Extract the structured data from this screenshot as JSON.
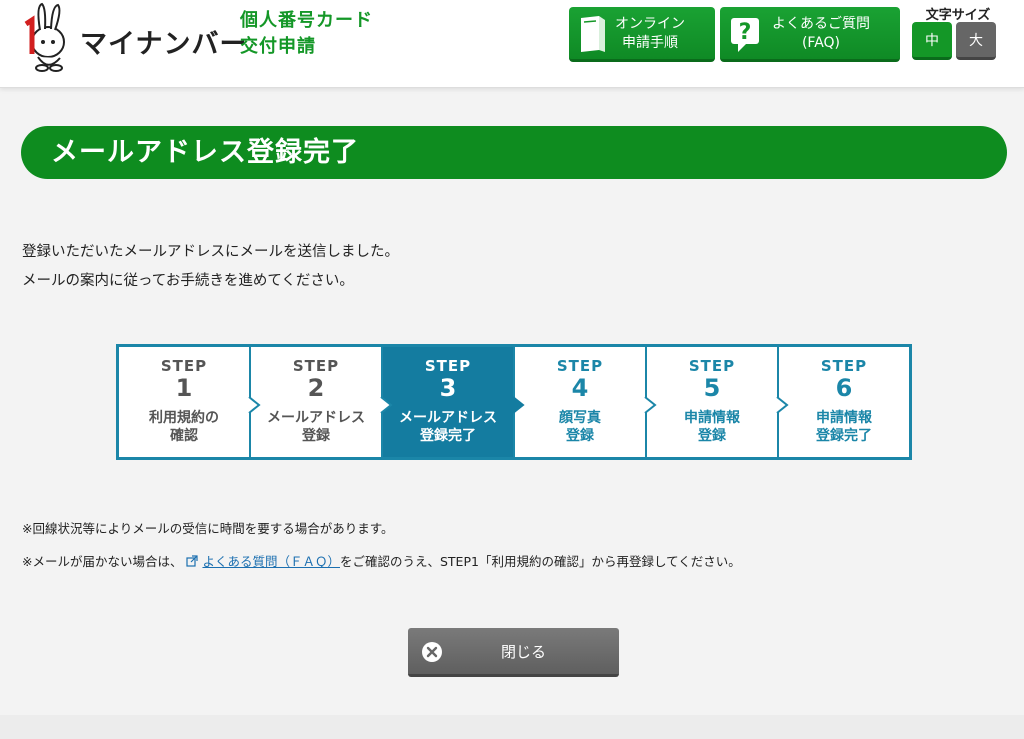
{
  "header": {
    "logo_text": "マイナンバー",
    "service_title_line1": "個人番号カード",
    "service_title_line2": "交付申請",
    "online_btn_line1": "オンライン",
    "online_btn_line2": "申請手順",
    "faq_btn_line1": "よくあるご質問",
    "faq_btn_line2": "(FAQ)",
    "font_size_label": "文字サイズ",
    "font_mid": "中",
    "font_large": "大"
  },
  "page_title": "メールアドレス登録完了",
  "message": {
    "line1": "登録いただいたメールアドレスにメールを送信しました。",
    "line2": "メールの案内に従ってお手続きを進めてください。"
  },
  "steps": [
    {
      "word": "STEP",
      "num": "1",
      "name1": "利用規約の",
      "name2": "確認"
    },
    {
      "word": "STEP",
      "num": "2",
      "name1": "メールアドレス",
      "name2": "登録"
    },
    {
      "word": "STEP",
      "num": "3",
      "name1": "メールアドレス",
      "name2": "登録完了"
    },
    {
      "word": "STEP",
      "num": "4",
      "name1": "顔写真",
      "name2": "登録"
    },
    {
      "word": "STEP",
      "num": "5",
      "name1": "申請情報",
      "name2": "登録"
    },
    {
      "word": "STEP",
      "num": "6",
      "name1": "申請情報",
      "name2": "登録完了"
    }
  ],
  "notes": {
    "line1": "※回線状況等によりメールの受信に時間を要する場合があります。",
    "line2_prefix": "※メールが届かない場合は、",
    "line2_link": "よくある質問（ＦＡＱ）",
    "line2_suffix": "をご確認のうえ、STEP1「利用規約の確認」から再登録してください。"
  },
  "close_button": "閉じる",
  "colors": {
    "brand_green": "#0e8c1f",
    "step_blue": "#147ca0",
    "close_gray": "#666666"
  },
  "icons": [
    "mascot-logo-icon",
    "book-icon",
    "question-icon",
    "external-link-icon",
    "close-circle-icon",
    "chevron-right-icon"
  ]
}
